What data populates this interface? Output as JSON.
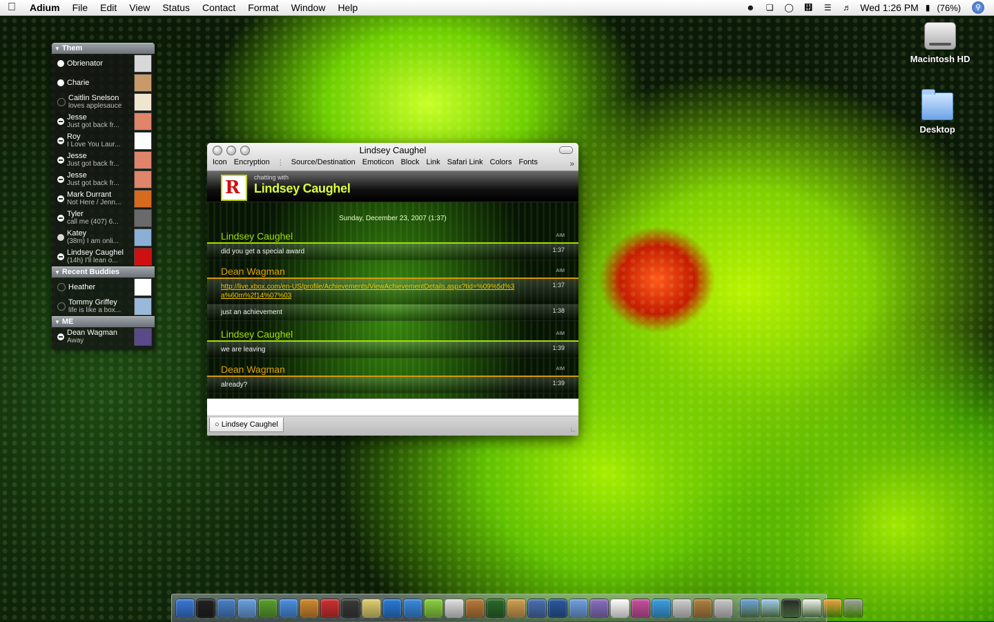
{
  "menubar": {
    "app": "Adium",
    "items": [
      "File",
      "Edit",
      "View",
      "Status",
      "Contact",
      "Format",
      "Window",
      "Help"
    ],
    "clock": "Wed 1:26 PM",
    "battery": "(76%)"
  },
  "desktop": {
    "icons": [
      "Macintosh HD",
      "Desktop"
    ]
  },
  "contact_list": {
    "groups": [
      {
        "name": "Them",
        "buddies": [
          {
            "name": "Obrienator",
            "status": "",
            "avatar_color": "#d8d8d8"
          },
          {
            "name": "Charie",
            "status": "",
            "avatar_color": "#c89a6a"
          },
          {
            "name": "Caitlin Snelson",
            "status": "loves applesauce",
            "avatar_color": "#f0e6d0"
          },
          {
            "name": "Jesse",
            "status": "Just got back fr...",
            "avatar_color": "#e0846a"
          },
          {
            "name": "Roy",
            "status": "I Love You Laur...",
            "avatar_color": "#ffffff"
          },
          {
            "name": "Jesse",
            "status": "Just got back fr...",
            "avatar_color": "#e0846a"
          },
          {
            "name": "Jesse",
            "status": "Just got back fr...",
            "avatar_color": "#e0846a"
          },
          {
            "name": "Mark Durrant",
            "status": "Not Here / Jenn...",
            "avatar_color": "#d86a20"
          },
          {
            "name": "Tyler",
            "status": "call me (407) 6...",
            "avatar_color": "#6a6a6a"
          },
          {
            "name": "Katey",
            "status": "(38m) I am onli...",
            "avatar_color": "#8ab0d8"
          },
          {
            "name": "Lindsey Caughel",
            "status": "(14h) I'll lean o...",
            "avatar_color": "#d01010"
          }
        ]
      },
      {
        "name": "Recent Buddies",
        "buddies": [
          {
            "name": "Heather",
            "status": "",
            "avatar_color": "#ffffff"
          },
          {
            "name": "Tommy Griffey",
            "status": "life is like a box...",
            "avatar_color": "#9ab8d8"
          }
        ]
      },
      {
        "name": "ME",
        "buddies": [
          {
            "name": "Dean Wagman",
            "status": "Away",
            "avatar_color": "#5a4a8a"
          }
        ]
      }
    ]
  },
  "chat_window": {
    "title": "Lindsey Caughel",
    "toolbar": [
      "Icon",
      "Encryption",
      "Source/Destination",
      "Emoticon",
      "Block",
      "Link",
      "Safari Link",
      "Colors",
      "Fonts"
    ],
    "header": {
      "chatting_with": "chatting with",
      "buddy": "Lindsey Caughel"
    },
    "date_line": "Sunday, December 23, 2007 (1:37)",
    "messages": [
      {
        "sender": "Lindsey Caughel",
        "service": "AIM",
        "lines": [
          {
            "text": "did you get a special award",
            "time": "1:37"
          }
        ]
      },
      {
        "sender": "Dean Wagman",
        "service": "AIM",
        "lines": [
          {
            "text": "http://live.xbox.com/en-US/profile/Achievements/ViewAchievementDetails.aspx?tid=%09%5d%3a%60m%2f14%07%03",
            "time": "1:37",
            "link": true
          },
          {
            "text": "just an achievement",
            "time": "1:38"
          }
        ]
      },
      {
        "sender": "Lindsey Caughel",
        "service": "AIM",
        "lines": [
          {
            "text": "we are leaving",
            "time": "1:39"
          }
        ]
      },
      {
        "sender": "Dean Wagman",
        "service": "AIM",
        "lines": [
          {
            "text": "already?",
            "time": "1:39"
          }
        ]
      }
    ],
    "tab_label": "Lindsey Caughel"
  },
  "dock": {
    "app_colors": [
      "#3a78d8",
      "#222222",
      "#4a80c8",
      "#6aa0e0",
      "#5aa030",
      "#4a90e0",
      "#d08a30",
      "#d03030",
      "#3a3a3a",
      "#e0d070",
      "#2a7ad8",
      "#3a8ae0",
      "#8ad040",
      "#e0e0e0",
      "#b87a3a",
      "#2a6a2a",
      "#d0a050",
      "#4a70b0",
      "#2a5aa0",
      "#70a0e0",
      "#8a70c0",
      "#ffffff",
      "#c850a0",
      "#3aa0e0",
      "#d0d0d0",
      "#b08040",
      "#c8c8c8"
    ],
    "right_colors": [
      "#6aa0e0",
      "#a0c8f0",
      "#222222",
      "#f0f0f0",
      "#f0a040",
      "#a0a0a0"
    ]
  }
}
